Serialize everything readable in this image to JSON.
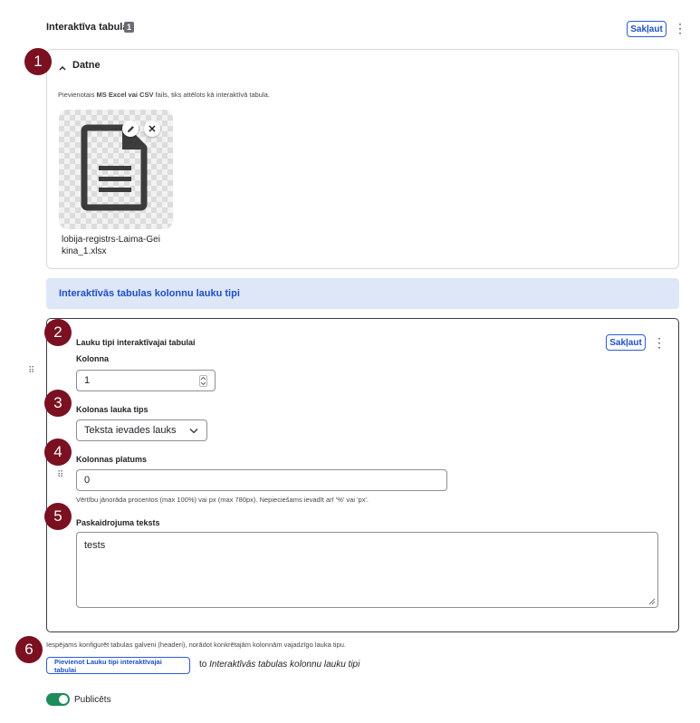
{
  "header": {
    "title": "Interaktīva tabula",
    "count_badge": "1",
    "collapse_label": "Sakļaut"
  },
  "file_section": {
    "toggle_label": "Datne",
    "description_prefix": "Pievienotais ",
    "description_bold": "MS Excel vai CSV",
    "description_suffix": " fails, tiks attēlots kā interaktīvā tabula.",
    "file_name": "lobija-registrs-Laima-Geikina_1.xlsx",
    "file_name_line1": "lobija-registrs-Laima-Gei",
    "file_name_line2": "kina_1.xlsx"
  },
  "section_banner": {
    "title": "Interaktīvās tabulas kolonnu lauku tipi"
  },
  "paragraph": {
    "title": "Lauku tipi interaktīvajai tabulai",
    "collapse_label": "Sakļaut",
    "column_label": "Kolonna",
    "column_value": "1",
    "type_label": "Kolonas lauka tips",
    "type_value": "Teksta ievades lauks",
    "width_label": "Kolonnas platums",
    "width_value": "0",
    "width_help": "Vērtību jānorāda procentos (max 100%) vai px (max 780px). Nepieciešams ievadīt arī '%' vai 'px'.",
    "explain_label": "Paskaidrojuma teksts",
    "explain_value": "tests"
  },
  "footer": {
    "help": "Iespējams konfigurēt tabulas galveni (headeri), norādot konkrētajām kolonnām vajadzīgo lauka tipu.",
    "add_button_label": "Pievienot Lauku tipi interaktīvajai tabulai",
    "to_text": "to ",
    "to_target": "Interaktīvās tabulas kolonnu lauku tipi",
    "published_label": "Publicēts"
  },
  "annotations": [
    "1",
    "2",
    "3",
    "4",
    "5",
    "6"
  ],
  "colors": {
    "accent": "#2c5ad9",
    "banner_bg": "#dde7f8",
    "banner_text": "#1e4fc7",
    "annotation": "#7a1020",
    "toggle_on": "#1f8a5a"
  },
  "icons": {
    "kebab": "⋮",
    "chevron_up": "^",
    "chevron_down": "chevron-down",
    "drag": "⠿",
    "pencil": "pencil",
    "close": "×",
    "document": "document"
  }
}
